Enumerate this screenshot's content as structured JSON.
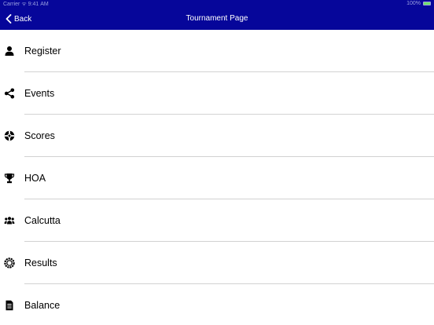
{
  "status_bar": {
    "left_text": "Carrier ᯤ  9:41 AM",
    "right_text": "100%",
    "battery_level": 1.0
  },
  "nav": {
    "back_label": "Back",
    "title": "Tournament Page",
    "bg_color": "#06069a"
  },
  "menu": {
    "items": [
      {
        "label": "Register",
        "icon": "user-icon"
      },
      {
        "label": "Events",
        "icon": "share-icon"
      },
      {
        "label": "Scores",
        "icon": "life-ring-icon"
      },
      {
        "label": "HOA",
        "icon": "trophy-icon"
      },
      {
        "label": "Calcutta",
        "icon": "group-icon"
      },
      {
        "label": "Results",
        "icon": "circle-notch-icon"
      },
      {
        "label": "Balance",
        "icon": "document-icon"
      }
    ]
  }
}
